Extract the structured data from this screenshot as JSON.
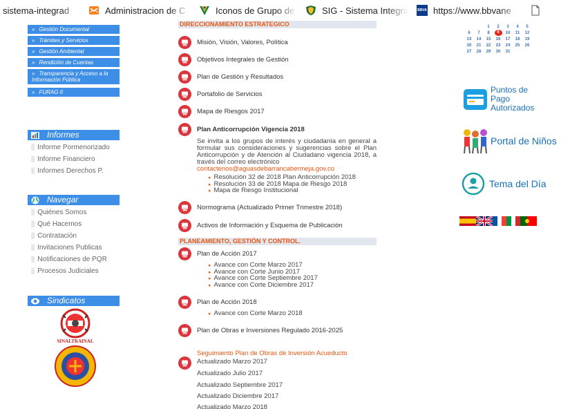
{
  "bookmarks": [
    {
      "label": "sistema-integrad",
      "icon": "page-icon"
    },
    {
      "label": "Administracion de C",
      "icon": "orange-mail-icon"
    },
    {
      "label": "Iconos de Grupo de",
      "icon": "green-v-icon"
    },
    {
      "label": "SIG - Sistema Integra",
      "icon": "shield-icon"
    },
    {
      "label": "https://www.bbvane",
      "icon": "bbva-icon",
      "icon_text": "BBVA"
    },
    {
      "label": "",
      "icon": "document-icon"
    }
  ],
  "left_menu": [
    "Gestión Documental",
    "Trámites y Servicios",
    "Gestión Ambiental",
    "Rendición de Cuentas",
    "Transparencia y Acceso a la Información Pública",
    "FURAG II"
  ],
  "informes": {
    "title": "Informes",
    "links": [
      "Informe Pormenorizado",
      "Informe Financiero",
      "Informes Derechos P."
    ]
  },
  "navegar": {
    "title": "Navegar",
    "links": [
      "Quiénes Somos",
      "Qué Hacemos",
      "Contratación",
      "Invitaciones Publicas",
      "Notificaciones de PQR",
      "Procesos Judiciales"
    ]
  },
  "sindicatos": {
    "title": "Sindicatos",
    "logo1_text": "SINALTRAINAL"
  },
  "direccionamiento": {
    "header": "DIRECCIONAMIENTO ESTRATEGICO",
    "items": [
      "Misión, Visión, Valores, Política",
      "Objetivos Integrales de Gestión",
      "Plan de Gestión y Resultados",
      "Portafolio de Servicios",
      "Mapa de Riesgos 2017",
      "Plan Anticorrupción Vigencia 2018"
    ],
    "paragraph": "Se invita a los grupos de interés y ciudadanía en general a formular sus consideraciones y sugerencias sobre el Plan Anticorrupción y de Atención al Ciudadano vigencia 2018, a través del correo electrónico",
    "email": "contactenos@aguasdebarrancabermeja.gov.co",
    "sub": [
      "Resolución 32 de 2018 Plan Anticorrupción 2018",
      "Resolución 33 de 2018 Mapa de Riesgo  2018",
      "Mapa de Riesgo Institucional"
    ],
    "normograma": "Normograma (Actualizado Primer Trimestre 2018)",
    "activos": "Activos de Información y Esquema de Publicación"
  },
  "planeamiento": {
    "header": "PLANEAMIENTO, GESTIÓN Y CONTROL.",
    "plan2017": "Plan de Acción 2017",
    "plan2017_sub": [
      "Avance con Corte Marzo 2017",
      "Avance con Corte Junio 2017",
      "Avance con Corte Septiembre 2017",
      "Avance con Corte Diciembre 2017"
    ],
    "plan2018": "Plan de Acción 2018",
    "plan2018_sub": [
      "Avance con Corte Marzo 2018"
    ],
    "obras": "Plan de Obras e Inversiones Regulado 2016-2025",
    "seguimiento": "Seguimiento Plan de Obras de Inversión Acueducto",
    "actualizados": [
      "Actualizado Marzo 2017",
      "Actualizado Julio 2017",
      "Actualizado Septiembre 2017",
      "Actualizado Diciembre 2017",
      "Actualizado Marzo 2018"
    ]
  },
  "calendar": {
    "weeks": [
      [
        "",
        "",
        "1",
        "2",
        "3",
        "4",
        "5"
      ],
      [
        "6",
        "7",
        "8",
        "9",
        "10",
        "11",
        "12"
      ],
      [
        "13",
        "14",
        "15",
        "16",
        "17",
        "18",
        "19"
      ],
      [
        "20",
        "21",
        "22",
        "23",
        "24",
        "25",
        "26"
      ],
      [
        "27",
        "28",
        "29",
        "30",
        "31",
        "",
        ""
      ]
    ],
    "today": "9"
  },
  "right_links": {
    "pago": "Puntos de Pago Autorizados",
    "ninos": "Portal de Niños",
    "tema": "Tema del Día"
  },
  "colors": {
    "menu_blue": "#3d8ee6",
    "accent_orange": "#e8540f",
    "pdf_red": "#d9363e",
    "header_bg": "#e2e7ef"
  }
}
